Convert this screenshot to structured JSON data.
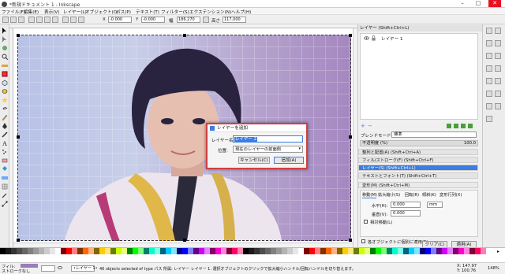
{
  "window": {
    "title": "*新規ドキュメント 1 - Inkscape"
  },
  "menu": [
    "ファイル(F)",
    "編集(E)",
    "表示(V)",
    "レイヤー(L)",
    "オブジェクト(O)",
    "パス(P)",
    "テキスト(T)",
    "フィルター(S)",
    "エクステンション(N)",
    "ヘルプ(H)"
  ],
  "controls": {
    "x_label": "X",
    "x_value": "-0.000",
    "y_label": "Y",
    "y_value": "-0.000",
    "w_label": "幅",
    "w_value": "186.270",
    "h_label": "高さ",
    "h_value": "117.000"
  },
  "layers_panel": {
    "title": "レイヤー (Shift+Ctrl+L)",
    "layer_name": "レイヤー 1"
  },
  "blend": {
    "label": "ブレンドモード:",
    "value": "標準"
  },
  "opacity": {
    "label": "不透明度 (%)",
    "value": "100.0"
  },
  "panels": [
    "整列と配置(A) (Shift+Ctrl+A)",
    "フィル/ストローク(F) (Shift+Ctrl+F)",
    "レイヤー(S) (Shift+Ctrl+L)",
    "テキストとフォント(T) (Shift+Ctrl+T)"
  ],
  "transform": {
    "title": "変形(M) (Shift+Ctrl+M)",
    "tabs": [
      "移動(M)",
      "拡大縮小(S)",
      "回転(R)",
      "傾斜(K)",
      "変形行列(X)"
    ],
    "h_label": "水平(H):",
    "h_value": "0.000",
    "v_label": "垂直(V):",
    "v_value": "0.000",
    "unit": "mm",
    "relative": "相対移動(L)",
    "apply_each": "各オブジェクトに個別に適用(E)",
    "clear": "クリア(C)",
    "apply": "適用(A)"
  },
  "dialog": {
    "title": "レイヤーを追加",
    "name_label": "レイヤー名:",
    "name_value": "レイヤー 2",
    "position_label": "位置:",
    "position_value": "現在のレイヤーの前面側",
    "cancel": "キャンセル(C)",
    "add": "追加(A)"
  },
  "status": {
    "fill_label": "フィル:",
    "stroke_label": "ストローク:",
    "none": "なし",
    "layer": "•レイヤー 1•",
    "message": "46 objects selected of type パス 所属: レイヤー レイヤー 1. 選択オブジェクトのクリックで拡大縮小ハンドル/回転ハンドルを切り替えます。",
    "x": "X: 147.97",
    "y": "Y: 100.76",
    "zoom": "148%"
  },
  "colors": {
    "accent": "#3b7de0",
    "dialog_border": "#d04040"
  }
}
